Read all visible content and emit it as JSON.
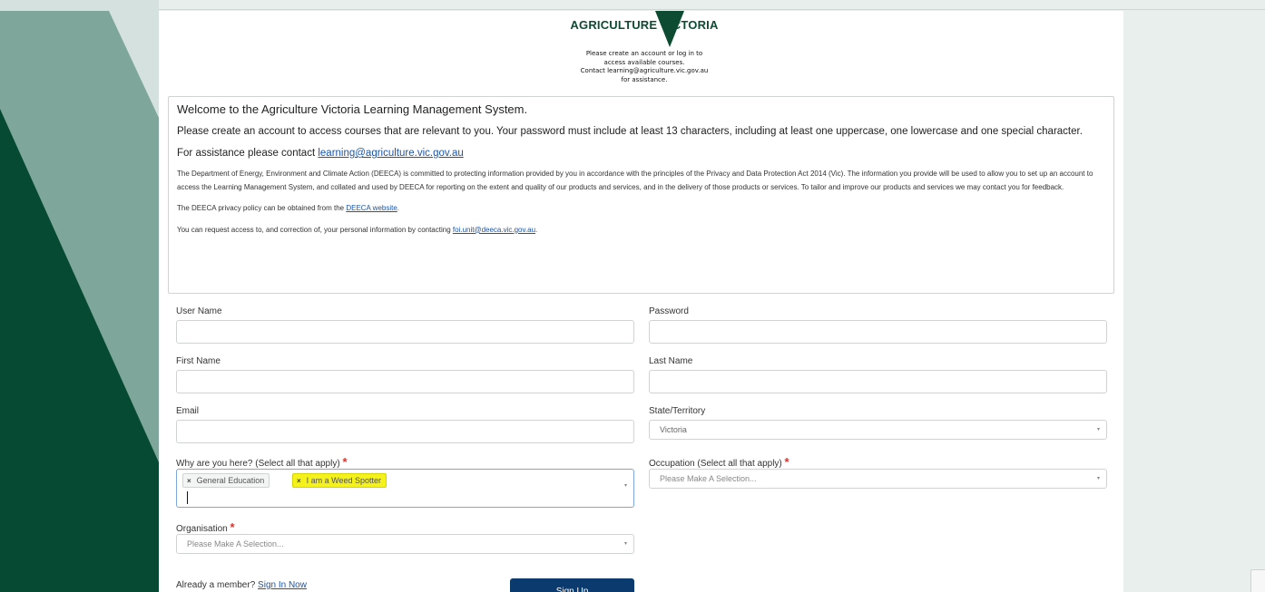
{
  "header": {
    "logo_text": "AGRICULTURE VICTORIA",
    "intro_line1": "Please create an account or log in to",
    "intro_line2": "access available courses.",
    "intro_line3": "Contact learning@agriculture.vic.gov.au",
    "intro_line4": "for assistance."
  },
  "info": {
    "title": "Welcome to the Agriculture Victoria Learning Management System.",
    "para1": "Please create an account to access courses that are relevant to you. Your password must include at least 13 characters, including at least one uppercase, one lowercase and one special character.",
    "assist_prefix": "For assistance please contact ",
    "assist_email": "learning@agriculture.vic.gov.au",
    "privacy_text": "The Department of Energy, Environment and Climate Action (DEECA) is committed to protecting information provided by you in accordance with the principles of the Privacy and Data Protection Act 2014 (Vic). The information you provide will be used to allow you to set up an account to access the Learning Management System, and collated and used by DEECA for reporting on the extent and quality of our products and services, and in the delivery of those products or services. To tailor and improve our products and services we may contact you for feedback.",
    "policy_prefix": "The DEECA privacy policy can be obtained from the ",
    "policy_link": "DEECA website",
    "policy_suffix": ".",
    "access_prefix": "You can request access to, and correction of, your personal information by contacting ",
    "access_email": "foi.unit@deeca.vic.gov.au",
    "access_suffix": "."
  },
  "form": {
    "username_label": "User Name",
    "password_label": "Password",
    "firstname_label": "First Name",
    "lastname_label": "Last Name",
    "email_label": "Email",
    "state_label": "State/Territory",
    "state_value": "Victoria",
    "why_label": "Why are you here? (Select all that apply)",
    "why_tags": [
      "General Education",
      "I am a Weed Spotter"
    ],
    "occupation_label": "Occupation (Select all that apply)",
    "occupation_placeholder": "Please Make A Selection...",
    "organisation_label": "Organisation",
    "organisation_placeholder": "Please Make A Selection...",
    "required_mark": "*",
    "tag_remove": "×",
    "caret": "▾"
  },
  "footer": {
    "already_prefix": "Already a member? ",
    "sign_in_link": "Sign In Now",
    "signup_button": "Sign Up"
  },
  "colors": {
    "brand_green": "#0d4b32",
    "button_blue": "#0b3b6e",
    "highlight": "#f4f21a",
    "required": "#e0312a"
  }
}
